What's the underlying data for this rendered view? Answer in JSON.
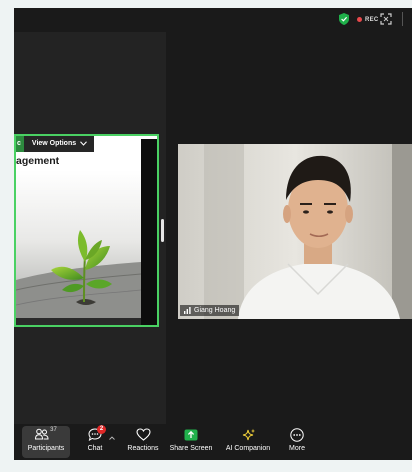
{
  "topbar": {
    "rec_label": "REC",
    "icons": [
      "shield-check-icon",
      "record-dot-icon",
      "fullscreen-icon"
    ]
  },
  "share": {
    "tag_text": "c",
    "view_options_label": "View Options",
    "slide_title": "agement"
  },
  "video": {
    "participant_name": "Giang Hoang"
  },
  "toolbar": {
    "participants": {
      "label": "Participants",
      "count": "37"
    },
    "chat": {
      "label": "Chat",
      "badge": "2"
    },
    "reactions": {
      "label": "Reactions"
    },
    "share_screen": {
      "label": "Share Screen"
    },
    "ai_companion": {
      "label": "AI Companion"
    },
    "more": {
      "label": "More"
    }
  },
  "colors": {
    "app_bg": "#1a1a1a",
    "active_speaker_border": "#4ad163",
    "share_screen_green": "#21b14c",
    "rec_red": "#e8484b",
    "badge_red": "#e02828",
    "ai_companion_yellow": "#f5d33a"
  }
}
